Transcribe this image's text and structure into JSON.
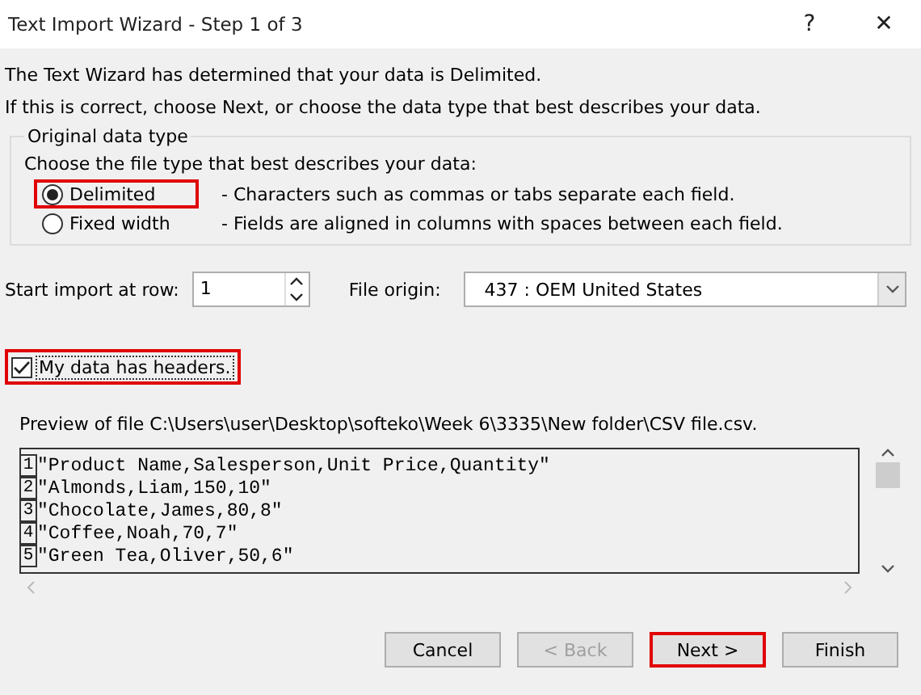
{
  "window": {
    "title": "Text Import Wizard - Step 1 of 3",
    "help": "?",
    "close": "✕"
  },
  "intro": [
    "The Text Wizard has determined that your data is Delimited.",
    "If this is correct, choose Next, or choose the data type that best describes your data."
  ],
  "group": {
    "title": "Original data type",
    "prompt": "Choose the file type that best describes your data:",
    "options": [
      {
        "label": "Delimited",
        "description": "- Characters such as commas or tabs separate each field.",
        "selected": true,
        "highlighted": true
      },
      {
        "label": "Fixed width",
        "description": "- Fields are aligned in columns with spaces between each field.",
        "selected": false,
        "highlighted": false
      }
    ]
  },
  "start_row": {
    "label": "Start import at row:",
    "value": "1"
  },
  "file_origin": {
    "label": "File origin:",
    "value": "437 : OEM United States"
  },
  "headers": {
    "label": "My data has headers.",
    "checked": true,
    "highlighted": true
  },
  "preview": {
    "caption": "Preview of file C:\\Users\\user\\Desktop\\softeko\\Week 6\\3335\\New folder\\CSV file.csv.",
    "lines": [
      {
        "number": "1",
        "text": "\"Product Name,Salesperson,Unit Price,Quantity\""
      },
      {
        "number": "2",
        "text": "\"Almonds,Liam,150,10\""
      },
      {
        "number": "3",
        "text": "\"Chocolate,James,80,8\""
      },
      {
        "number": "4",
        "text": "\"Coffee,Noah,70,7\""
      },
      {
        "number": "5",
        "text": "\"Green Tea,Oliver,50,6\""
      }
    ]
  },
  "buttons": [
    {
      "label": "Cancel",
      "disabled": false,
      "highlighted": false
    },
    {
      "label": "< Back",
      "disabled": true,
      "highlighted": false
    },
    {
      "label": "Next >",
      "disabled": false,
      "highlighted": true
    },
    {
      "label": "Finish",
      "disabled": false,
      "highlighted": false
    }
  ]
}
